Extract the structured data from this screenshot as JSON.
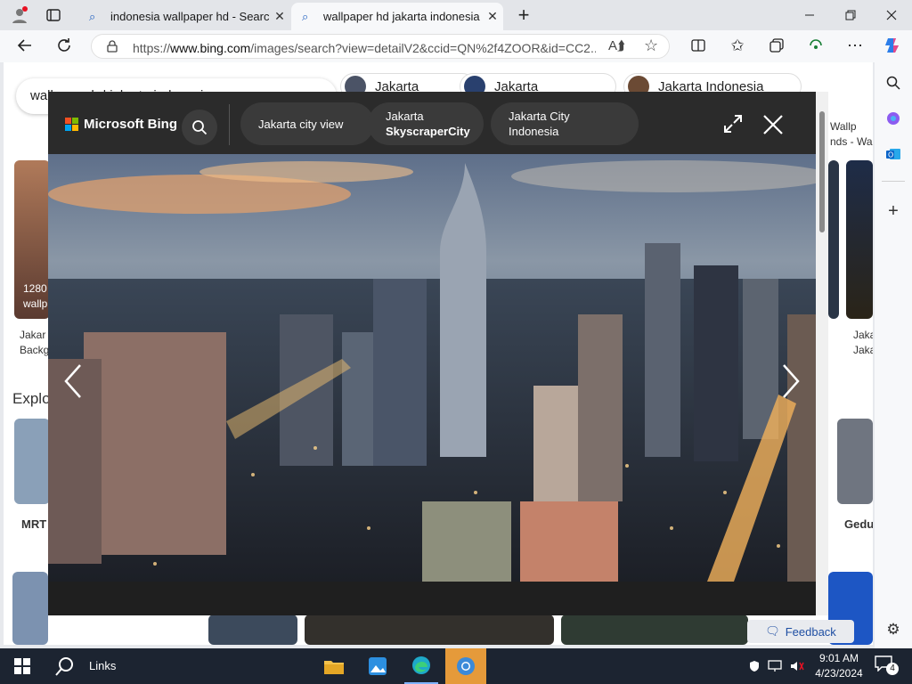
{
  "tabs": [
    {
      "title": "indonesia wallpaper hd - Search",
      "active": false
    },
    {
      "title": "wallpaper hd jakarta indonesia - ",
      "active": true
    }
  ],
  "address": {
    "prefix": "https://",
    "domain": "www.bing.com",
    "path": "/images/search?view=detailV2&ccid=QN%2f4ZOOR&id=CC2..."
  },
  "page": {
    "search_value": "wallpaper hd jakarta indonesia",
    "chips": [
      "Jakarta",
      "Jakarta",
      "Jakarta Indonesia"
    ],
    "left_caption": [
      "Jakar",
      "Backg"
    ],
    "left_overlay": [
      "1280",
      "wallp"
    ],
    "right_caption_top": [
      "Wallp",
      "nds - Wa"
    ],
    "right_caption": [
      "Jaka",
      "Jaka"
    ],
    "explore_label": "Explo",
    "bottom_left_label": "MRT",
    "bottom_right_label": "Gedu",
    "feedback_label": "Feedback"
  },
  "modal": {
    "brand": "Microsoft Bing",
    "suggestions": [
      {
        "line1": "Jakarta city view",
        "line2": ""
      },
      {
        "line1": "Jakarta",
        "line2": "SkyscraperCity"
      },
      {
        "line1": "Jakarta City Indonesia",
        "line2": ""
      }
    ]
  },
  "taskbar": {
    "links_label": "Links",
    "time": "9:01 AM",
    "date": "4/23/2024",
    "notifications": "4"
  },
  "colors": {
    "bing_dark": "#1f1f1f",
    "taskbar": "#1c2431",
    "accent": "#0078d4"
  },
  "icons": [
    "profile-icon",
    "tab-actions-icon",
    "search-tab-icon",
    "new-tab-icon",
    "back-icon",
    "refresh-icon",
    "lock-icon",
    "read-aloud-icon",
    "favorite-icon",
    "split-screen-icon",
    "favorites-icon",
    "collections-icon",
    "performance-icon",
    "more-icon",
    "copilot-icon",
    "windows-start-icon",
    "search-taskbar-icon",
    "file-explorer-icon",
    "photos-icon",
    "edge-icon",
    "chrome-icon",
    "security-icon",
    "network-icon",
    "volume-icon",
    "notification-icon",
    "settings-icon",
    "outlook-icon",
    "add-icon"
  ]
}
